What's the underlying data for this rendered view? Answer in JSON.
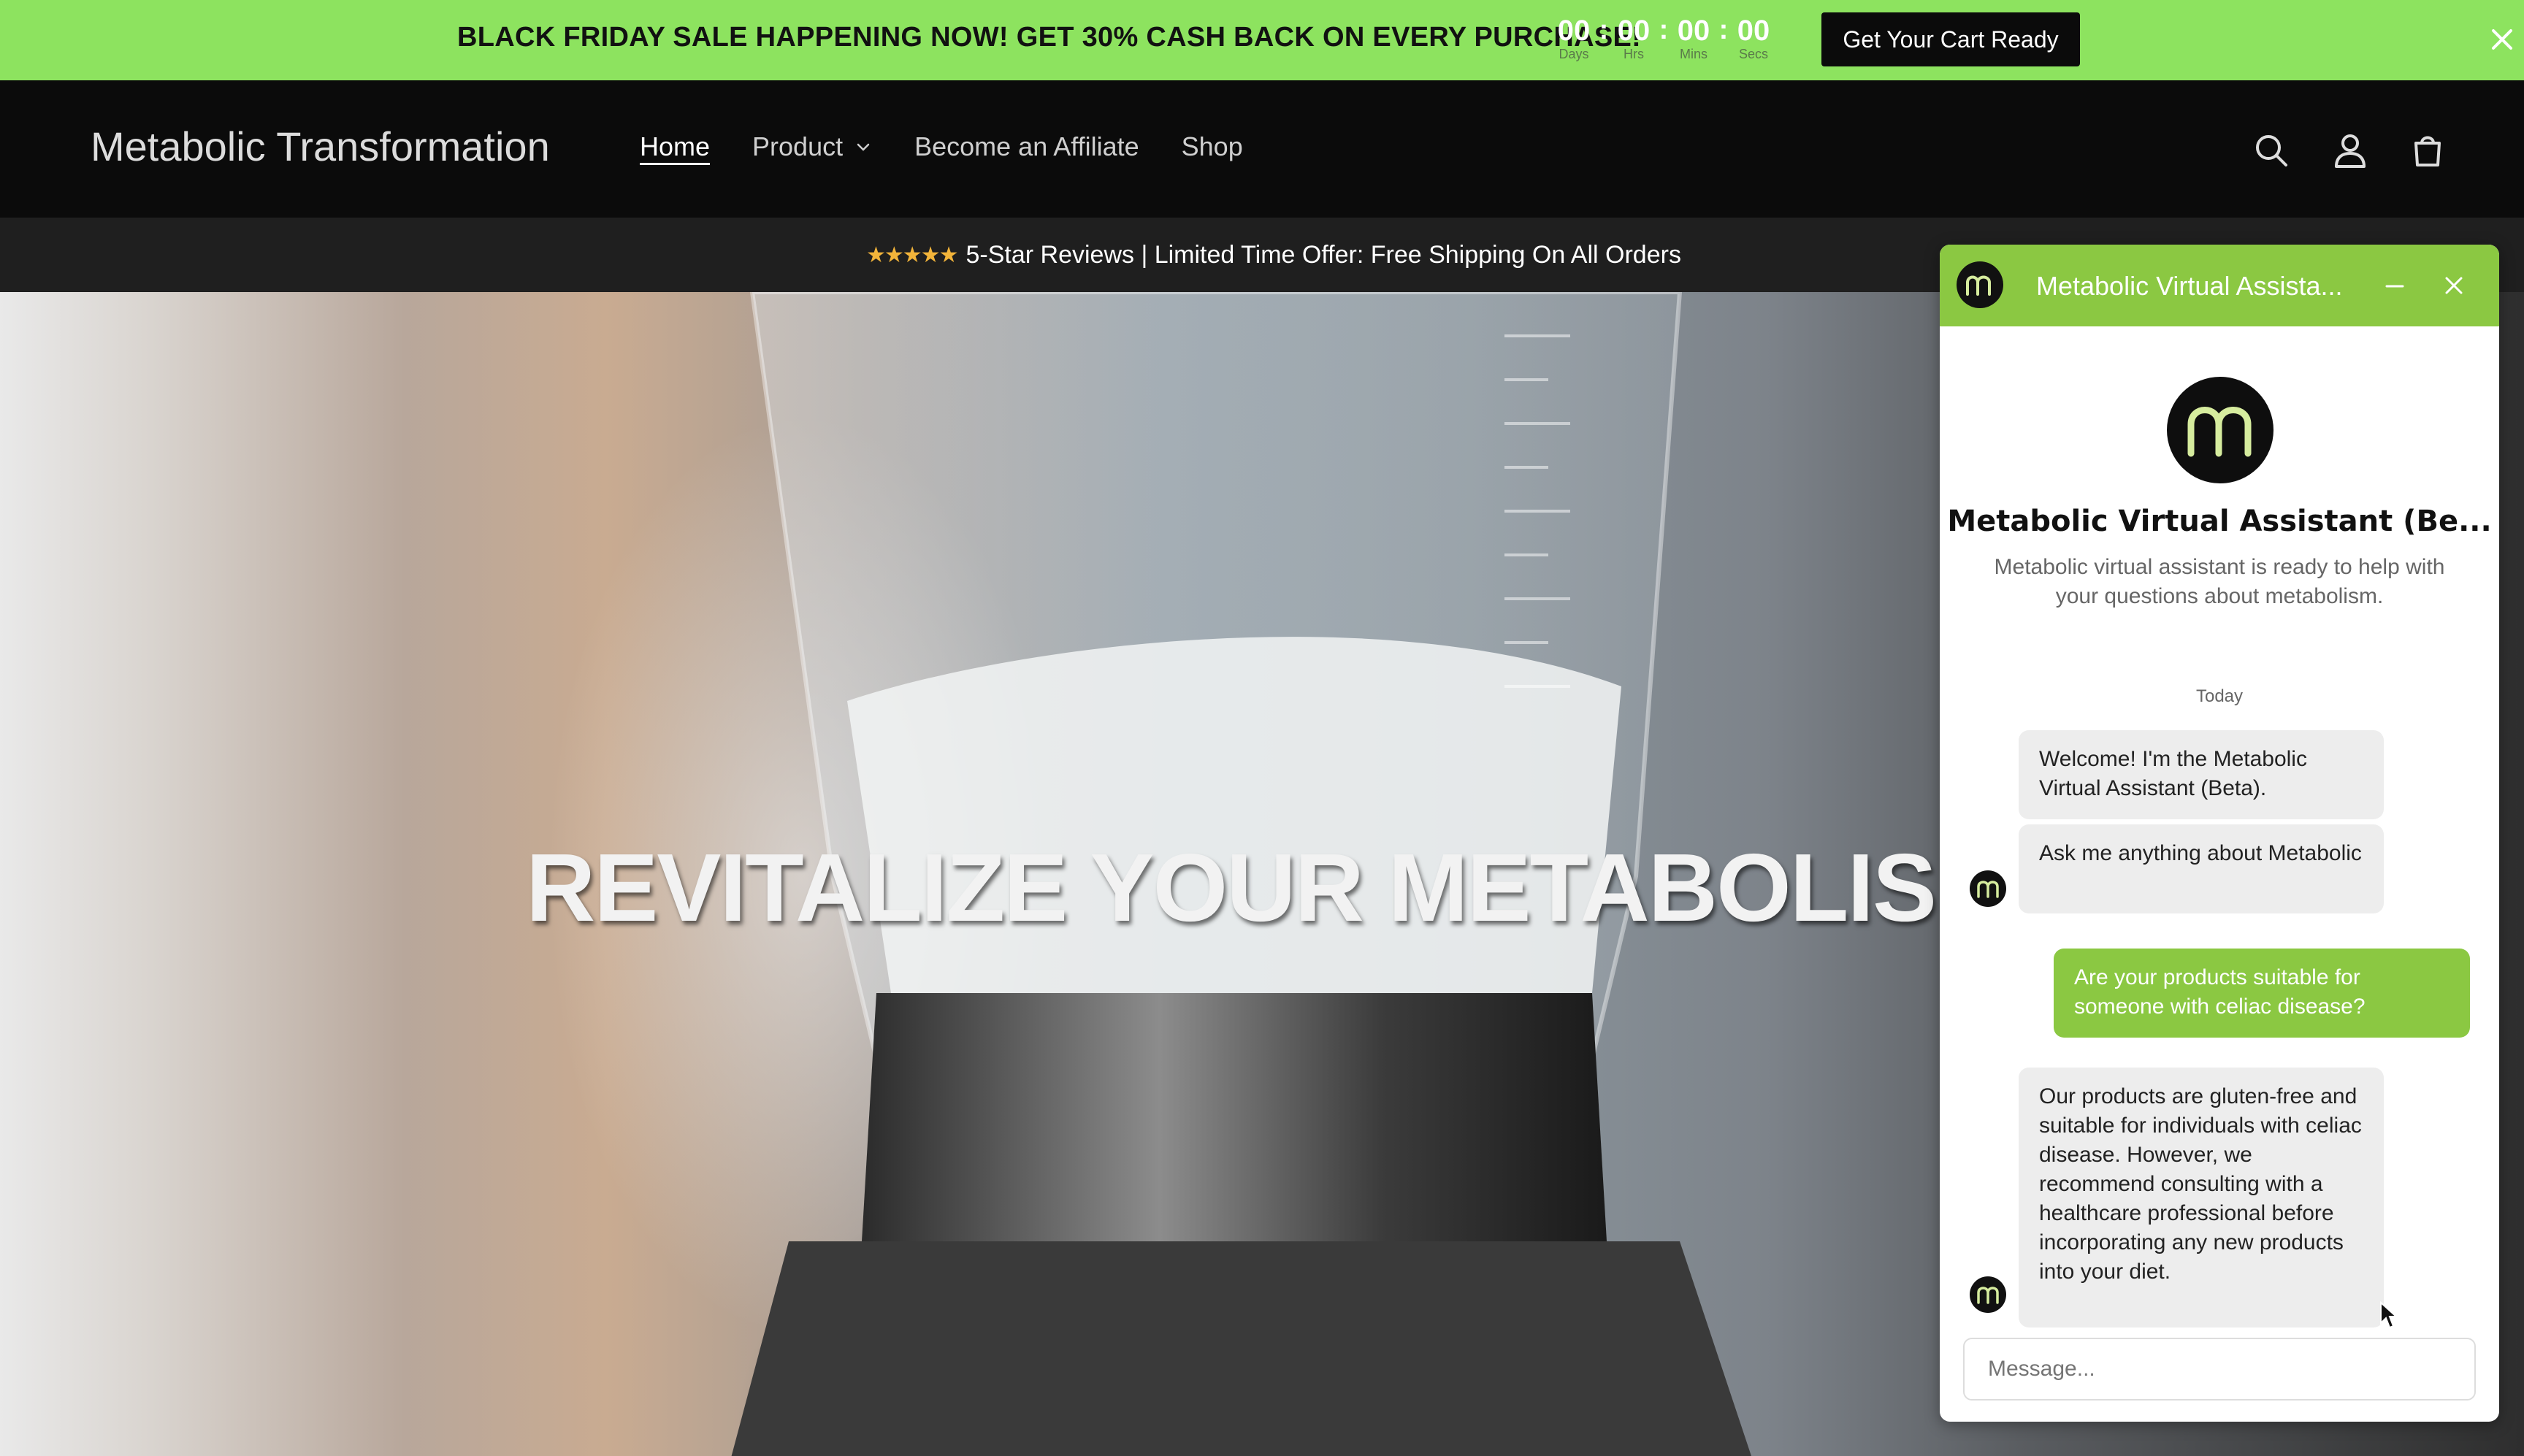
{
  "promo": {
    "text": "BLACK FRIDAY SALE HAPPENING NOW! GET 30% CASH BACK ON EVERY PURCHASE!",
    "countdown": [
      {
        "value": "00",
        "label": "Days"
      },
      {
        "value": "00",
        "label": "Hrs"
      },
      {
        "value": "00",
        "label": "Mins"
      },
      {
        "value": "00",
        "label": "Secs"
      }
    ],
    "button": "Get Your Cart Ready",
    "color": "#8de35f"
  },
  "header": {
    "brand": "Metabolic Transformation",
    "nav": [
      {
        "label": "Home",
        "active": true
      },
      {
        "label": "Product",
        "dropdown": true
      },
      {
        "label": "Become an Affiliate"
      },
      {
        "label": "Shop"
      }
    ],
    "icons": [
      "search-icon",
      "account-icon",
      "cart-icon"
    ]
  },
  "announcement": {
    "stars": "★★★★★",
    "text": "5-Star Reviews | Limited Time Offer: Free Shipping On All Orders"
  },
  "hero": {
    "title": "REVITALIZE YOUR METABOLISM"
  },
  "chat": {
    "header_title": "Metabolic Virtual Assista...",
    "title": "Metabolic Virtual Assistant (Be...",
    "description": "Metabolic virtual assistant is ready to help with your questions about metabolism.",
    "date": "Today",
    "messages": [
      {
        "from": "bot",
        "text": "Welcome! I'm the Metabolic Virtual Assistant (Beta)."
      },
      {
        "from": "bot",
        "text": "Ask me anything about Metabolic"
      },
      {
        "from": "user",
        "text": "Are your products suitable for someone with celiac disease?"
      },
      {
        "from": "bot",
        "text": "Our products are gluten-free and suitable for individuals with celiac disease. However, we recommend consulting with a healthcare professional before incorporating any new products into your diet."
      }
    ],
    "input_placeholder": "Message...",
    "accent": "#8bc842"
  }
}
